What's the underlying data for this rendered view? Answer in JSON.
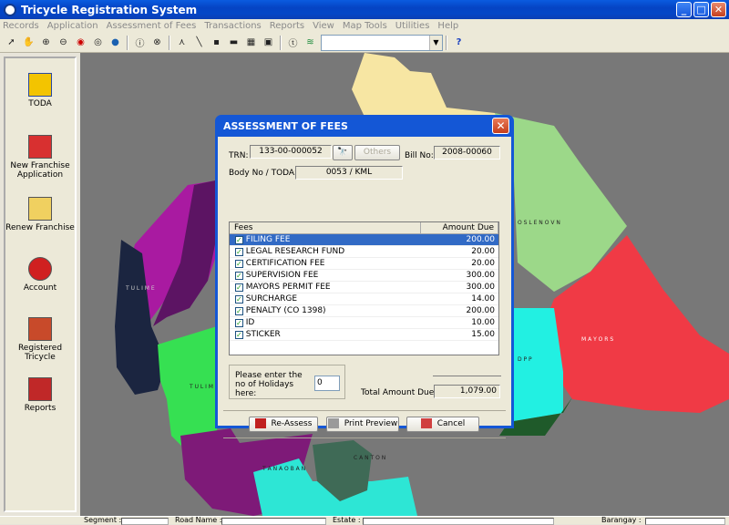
{
  "window": {
    "title": "Tricycle Registration System",
    "minimize": "_",
    "maximize": "□",
    "close": "✕"
  },
  "menu": [
    "Records",
    "Application",
    "Assessment of Fees",
    "Transactions",
    "Reports",
    "View",
    "Map Tools",
    "Utilities",
    "Help"
  ],
  "sidebar": {
    "items": [
      {
        "label": "TODA",
        "icon": "toda-icon"
      },
      {
        "label": "New Franchise Application",
        "icon": "franchise-icon"
      },
      {
        "label": "Renew Franchise",
        "icon": "renew-icon"
      },
      {
        "label": "Account",
        "icon": "account-icon"
      },
      {
        "label": "Registered Tricycle",
        "icon": "tricycle-icon"
      },
      {
        "label": "Reports",
        "icon": "reports-icon"
      }
    ]
  },
  "map": {
    "labels": [
      "O S L E N O V N",
      "T U L I M E",
      "M A Y O R S",
      "D P P",
      "T U L I M E",
      "C A N T O N",
      "T A N A O B A N"
    ]
  },
  "statusbar": {
    "segment": "Segment :",
    "road": "Road Name :",
    "estate": "Estate :",
    "barangay": "Barangay :"
  },
  "dialog": {
    "title": "ASSESSMENT OF FEES",
    "trn_label": "TRN:",
    "trn": "133-00-000052",
    "others": "Others",
    "bill_label": "Bill No:",
    "bill": "2008-00060",
    "body_label": "Body No / TODA:",
    "body": "0053 / KML",
    "fees_header": "Fees",
    "amount_header": "Amount Due",
    "fees": [
      {
        "name": "FILING FEE",
        "amount": "200.00"
      },
      {
        "name": "LEGAL RESEARCH FUND",
        "amount": "20.00"
      },
      {
        "name": "CERTIFICATION FEE",
        "amount": "20.00"
      },
      {
        "name": "SUPERVISION FEE",
        "amount": "300.00"
      },
      {
        "name": "MAYORS PERMIT FEE",
        "amount": "300.00"
      },
      {
        "name": "SURCHARGE",
        "amount": "14.00"
      },
      {
        "name": "PENALTY (CO 1398)",
        "amount": "200.00"
      },
      {
        "name": "ID",
        "amount": "10.00"
      },
      {
        "name": "STICKER",
        "amount": "15.00"
      }
    ],
    "holidays_prompt": "Please enter the no of Holidays here:",
    "holidays": "0",
    "total_label": "Total Amount Due:",
    "total": "1,079.00",
    "reassess": "Re-Assess",
    "print": "Print Preview",
    "cancel": "Cancel"
  },
  "colors": {
    "title_blue": "#0a5be0",
    "selection": "#316ac5",
    "map_gray": "#787878"
  }
}
